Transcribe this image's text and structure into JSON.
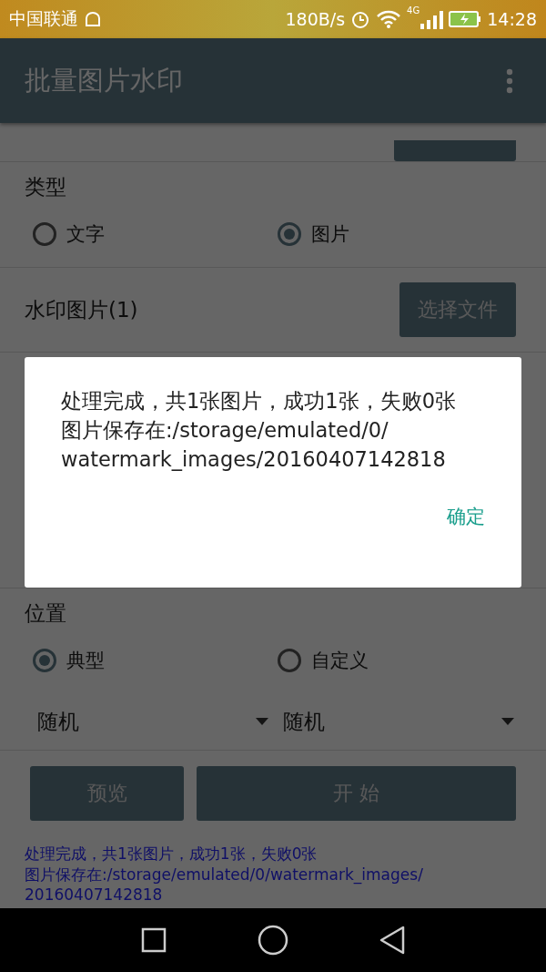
{
  "status_bar": {
    "carrier": "中国联通",
    "speed": "180B/s",
    "network": "4G",
    "time": "14:28"
  },
  "app_bar": {
    "title": "批量图片水印"
  },
  "type_section": {
    "label": "类型",
    "options": [
      {
        "label": "文字",
        "selected": false
      },
      {
        "label": "图片",
        "selected": true
      }
    ]
  },
  "watermark_image": {
    "label": "水印图片(1)",
    "button": "选择文件"
  },
  "position_section": {
    "label": "位置",
    "options": [
      {
        "label": "典型",
        "selected": true
      },
      {
        "label": "自定义",
        "selected": false
      }
    ],
    "dropdowns": [
      "随机",
      "随机"
    ]
  },
  "buttons": [
    {
      "label": "预览"
    },
    {
      "label": "开 始"
    }
  ],
  "result_lines": [
    "处理完成，共1张图片，成功1张，失败0张",
    "图片保存在:/storage/emulated/0/watermark_images/",
    "20160407142818"
  ],
  "dialog": {
    "message_lines": [
      "处理完成，共1张图片，成功1张，失败0张",
      "图片保存在:/storage/emulated/0/",
      "watermark_images/20160407142818"
    ],
    "button": "确定"
  }
}
